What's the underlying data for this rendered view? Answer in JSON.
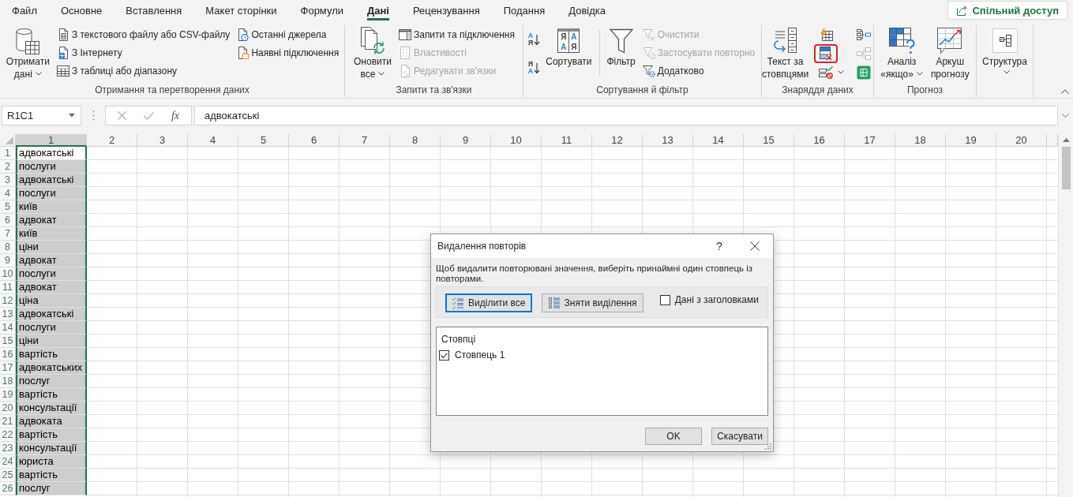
{
  "tabs": [
    {
      "label": "Файл",
      "selected": false
    },
    {
      "label": "Основне",
      "selected": false
    },
    {
      "label": "Вставлення",
      "selected": false
    },
    {
      "label": "Макет сторінки",
      "selected": false
    },
    {
      "label": "Формули",
      "selected": false
    },
    {
      "label": "Дані",
      "selected": true
    },
    {
      "label": "Рецензування",
      "selected": false
    },
    {
      "label": "Подання",
      "selected": false
    },
    {
      "label": "Довідка",
      "selected": false
    }
  ],
  "share_button": {
    "label": "Спільний доступ"
  },
  "ribbon_groups": [
    {
      "label": "Отримання та перетворення даних",
      "items": [
        {
          "kind": "large",
          "lines": [
            "Отримати",
            "дані"
          ],
          "dropdown": true
        },
        {
          "kind": "column",
          "items": [
            {
              "label": "З текстового файлу або CSV-файлу",
              "disabled": false
            },
            {
              "label": "З Інтернету",
              "disabled": false
            },
            {
              "label": "З таблиці або діапазону",
              "disabled": false
            }
          ]
        },
        {
          "kind": "column",
          "items": [
            {
              "label": "Останні джерела",
              "disabled": false
            },
            {
              "label": "Наявні підключення",
              "disabled": false
            }
          ]
        }
      ]
    },
    {
      "label": "Запити та зв'язки",
      "items": [
        {
          "kind": "large",
          "lines": [
            "Оновити",
            "все"
          ],
          "dropdown": true
        },
        {
          "kind": "column",
          "items": [
            {
              "label": "Запити та підключення",
              "disabled": false
            },
            {
              "label": "Властивості",
              "disabled": true
            },
            {
              "label": "Редагувати зв'язки",
              "disabled": true
            }
          ]
        }
      ]
    },
    {
      "label": "Сортування й фільтр",
      "items": [
        {
          "kind": "sort_pair",
          "buttons": [
            {
              "letters": [
                "А",
                "Я"
              ]
            },
            {
              "letters": [
                "Я",
                "А"
              ]
            }
          ]
        },
        {
          "kind": "sort_grid",
          "lines": [
            "Сортувати"
          ],
          "letters": [
            "Я",
            "А",
            "А",
            "Я"
          ]
        },
        {
          "kind": "separator"
        },
        {
          "kind": "large",
          "lines": [
            "Фільтр"
          ],
          "dropdown": false
        },
        {
          "kind": "column",
          "items": [
            {
              "label": "Очистити",
              "disabled": true
            },
            {
              "label": "Застосувати повторно",
              "disabled": true
            },
            {
              "label": "Додатково",
              "disabled": false
            }
          ]
        }
      ]
    },
    {
      "label": "Знаряддя даних",
      "items": [
        {
          "kind": "large",
          "lines": [
            "Текст за",
            "стовпцями"
          ],
          "dropdown": false
        },
        {
          "kind": "icon_column",
          "items": [
            {
              "disabled": false,
              "highlighted": false,
              "dropdown": false
            },
            {
              "disabled": false,
              "highlighted": true,
              "dropdown": false
            },
            {
              "disabled": false,
              "highlighted": false,
              "dropdown": true
            }
          ]
        },
        {
          "kind": "icon_column",
          "items": [
            {
              "disabled": false,
              "highlighted": false,
              "dropdown": false
            },
            {
              "disabled": true,
              "highlighted": false,
              "dropdown": false
            },
            {
              "disabled": false,
              "highlighted": false,
              "dropdown": false
            }
          ]
        }
      ]
    },
    {
      "label": "Прогноз",
      "items": [
        {
          "kind": "large",
          "lines": [
            "Аналіз",
            "«якщо»"
          ],
          "dropdown": true
        },
        {
          "kind": "large",
          "lines": [
            "Аркуш",
            "прогнозу"
          ],
          "dropdown": false
        }
      ]
    },
    {
      "items": [
        {
          "kind": "boxed",
          "lines": [
            "Структура"
          ],
          "dropdown": true
        }
      ]
    }
  ],
  "formula_bar": {
    "name_box": "R1C1",
    "function_label": "fx",
    "formula": "адвокатські"
  },
  "sheet": {
    "columns": [
      {
        "label": "1",
        "selected": true
      },
      {
        "label": "2",
        "selected": false
      },
      {
        "label": "3",
        "selected": false
      },
      {
        "label": "4",
        "selected": false
      },
      {
        "label": "5",
        "selected": false
      },
      {
        "label": "6",
        "selected": false
      },
      {
        "label": "7",
        "selected": false
      },
      {
        "label": "8",
        "selected": false
      },
      {
        "label": "9",
        "selected": false
      },
      {
        "label": "10",
        "selected": false
      },
      {
        "label": "11",
        "selected": false
      },
      {
        "label": "12",
        "selected": false
      },
      {
        "label": "13",
        "selected": false
      },
      {
        "label": "14",
        "selected": false
      },
      {
        "label": "15",
        "selected": false
      },
      {
        "label": "16",
        "selected": false
      },
      {
        "label": "17",
        "selected": false
      },
      {
        "label": "18",
        "selected": false
      },
      {
        "label": "19",
        "selected": false
      },
      {
        "label": "20",
        "selected": false
      }
    ],
    "rows": [
      {
        "number": "1",
        "value": "адвокатські",
        "active": true
      },
      {
        "number": "2",
        "value": "послуги",
        "active": false
      },
      {
        "number": "3",
        "value": "адвокатські",
        "active": false
      },
      {
        "number": "4",
        "value": "послуги",
        "active": false
      },
      {
        "number": "5",
        "value": "київ",
        "active": false
      },
      {
        "number": "6",
        "value": "адвокат",
        "active": false
      },
      {
        "number": "7",
        "value": "київ",
        "active": false
      },
      {
        "number": "8",
        "value": "ціни",
        "active": false
      },
      {
        "number": "9",
        "value": "адвокат",
        "active": false
      },
      {
        "number": "10",
        "value": "послуги",
        "active": false
      },
      {
        "number": "11",
        "value": "адвокат",
        "active": false
      },
      {
        "number": "12",
        "value": "ціна",
        "active": false
      },
      {
        "number": "13",
        "value": "адвокатські",
        "active": false
      },
      {
        "number": "14",
        "value": "послуги",
        "active": false
      },
      {
        "number": "15",
        "value": "ціни",
        "active": false
      },
      {
        "number": "16",
        "value": "вартість",
        "active": false
      },
      {
        "number": "17",
        "value": "адвокатських",
        "active": false
      },
      {
        "number": "18",
        "value": "послуг",
        "active": false
      },
      {
        "number": "19",
        "value": "вартість",
        "active": false
      },
      {
        "number": "20",
        "value": "консультації",
        "active": false
      },
      {
        "number": "21",
        "value": "адвоката",
        "active": false
      },
      {
        "number": "22",
        "value": "вартість",
        "active": false
      },
      {
        "number": "23",
        "value": "консультації",
        "active": false
      },
      {
        "number": "24",
        "value": "юриста",
        "active": false
      },
      {
        "number": "25",
        "value": "вартість",
        "active": false
      },
      {
        "number": "26",
        "value": "послуг",
        "active": false
      }
    ]
  },
  "dialog": {
    "title": "Видалення повторів",
    "help": "?",
    "message": "Щоб видалити повторювані значення, виберіть принаймні один стовпець із повторами.",
    "select_buttons": [
      {
        "label": "Виділити все",
        "focused": true
      },
      {
        "label": "Зняти виділення",
        "focused": false
      }
    ],
    "headers_checkbox": {
      "label": "Дані з заголовками",
      "checked": false
    },
    "columns_list": {
      "header": "Стовпці",
      "items": [
        {
          "label": "Стовпець 1",
          "checked": true
        }
      ]
    },
    "buttons": [
      {
        "label": "OK"
      },
      {
        "label": "Скасувати"
      }
    ]
  }
}
